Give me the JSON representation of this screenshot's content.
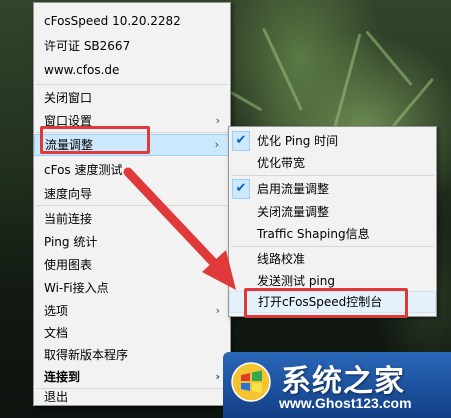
{
  "main_menu": {
    "items": [
      {
        "label": "cFosSpeed 10.20.2282"
      },
      {
        "label": "许可证 SB2667"
      },
      {
        "label": "www.cfos.de"
      },
      {
        "label": "关闭窗口"
      },
      {
        "label": "窗口设置"
      },
      {
        "label": "流量调整"
      },
      {
        "label": "cFos 速度测试"
      },
      {
        "label": "速度向导"
      },
      {
        "label": "当前连接"
      },
      {
        "label": "Ping 统计"
      },
      {
        "label": "使用图表"
      },
      {
        "label": "Wi-Fi接入点"
      },
      {
        "label": "选项"
      },
      {
        "label": "文档"
      },
      {
        "label": "取得新版本程序"
      },
      {
        "label": "连接到"
      },
      {
        "label": "退出"
      }
    ],
    "submenu_arrow": "›"
  },
  "submenu": {
    "items": [
      {
        "label": "优化 Ping 时间",
        "checked": true
      },
      {
        "label": "优化带宽",
        "checked": false
      },
      {
        "label": "启用流量调整",
        "checked": true
      },
      {
        "label": "关闭流量调整",
        "checked": false
      },
      {
        "label": "Traffic Shaping信息",
        "checked": false
      },
      {
        "label": "线路校准",
        "checked": false
      },
      {
        "label": "发送测试 ping",
        "checked": false
      },
      {
        "label": "打开cFosSpeed控制台",
        "checked": false
      }
    ],
    "check_glyph": "✔"
  },
  "watermark": {
    "title": "系统之家",
    "url": "www.Ghost123.com"
  },
  "colors": {
    "menu_bg": "#f2f2f2",
    "selection_bg": "#cce8ff",
    "highlight_box": "#e0393a",
    "annotation_arrow": "#e0393a",
    "watermark_bg": "#1e56a8"
  }
}
